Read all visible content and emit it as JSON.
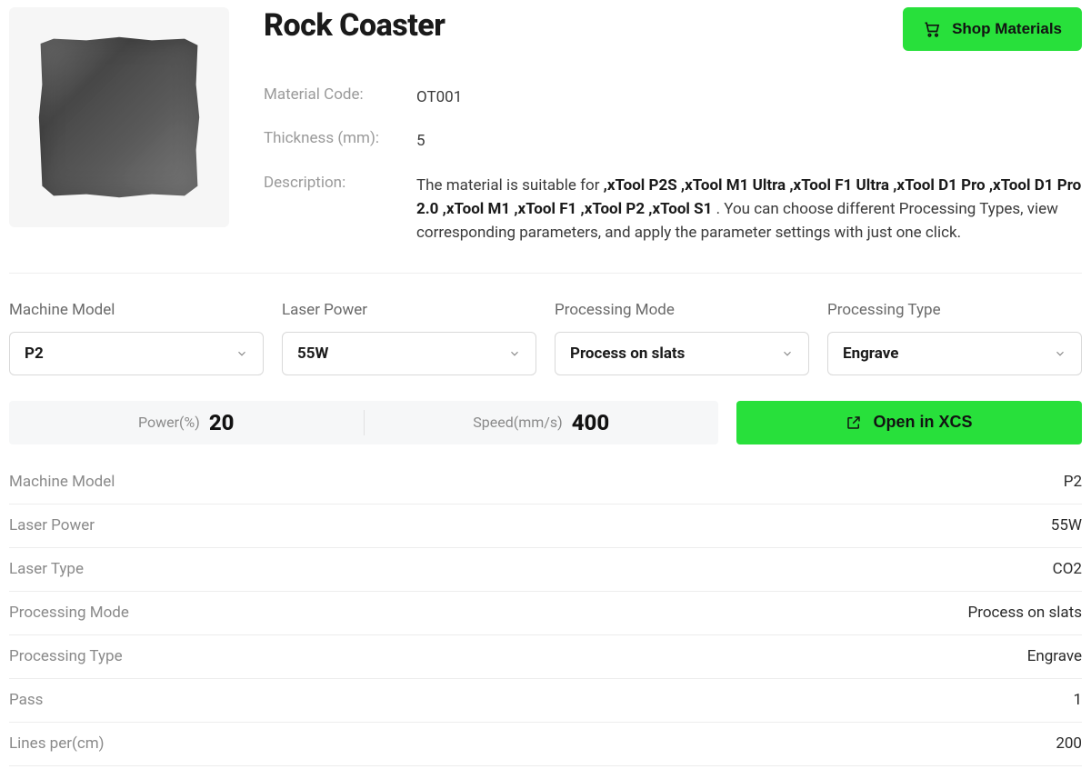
{
  "header": {
    "title": "Rock Coaster",
    "shop_button": "Shop Materials"
  },
  "meta": {
    "code_label": "Material Code:",
    "code_value": "OT001",
    "thickness_label": "Thickness (mm):",
    "thickness_value": "5",
    "description_label": "Description:",
    "description_prefix": "The material is suitable for ",
    "description_bold": ",xTool P2S ,xTool M1 Ultra ,xTool F1 Ultra ,xTool D1 Pro ,xTool D1 Pro 2.0 ,xTool M1 ,xTool F1 ,xTool P2 ,xTool S1",
    "description_suffix": " . You can choose different Processing Types, view corresponding parameters, and apply the parameter settings with just one click."
  },
  "selectors": {
    "machine_model": {
      "label": "Machine Model",
      "value": "P2"
    },
    "laser_power": {
      "label": "Laser Power",
      "value": "55W"
    },
    "processing_mode": {
      "label": "Processing Mode",
      "value": "Process on slats"
    },
    "processing_type": {
      "label": "Processing Type",
      "value": "Engrave"
    }
  },
  "summary": {
    "power_label": "Power(%)",
    "power_value": "20",
    "speed_label": "Speed(mm/s)",
    "speed_value": "400",
    "open_xcs": "Open in XCS"
  },
  "details": [
    {
      "k": "Machine Model",
      "v": "P2"
    },
    {
      "k": "Laser Power",
      "v": "55W"
    },
    {
      "k": "Laser Type",
      "v": "CO2"
    },
    {
      "k": "Processing Mode",
      "v": "Process on slats"
    },
    {
      "k": "Processing Type",
      "v": "Engrave"
    },
    {
      "k": "Pass",
      "v": "1"
    },
    {
      "k": "Lines per(cm)",
      "v": "200"
    }
  ]
}
